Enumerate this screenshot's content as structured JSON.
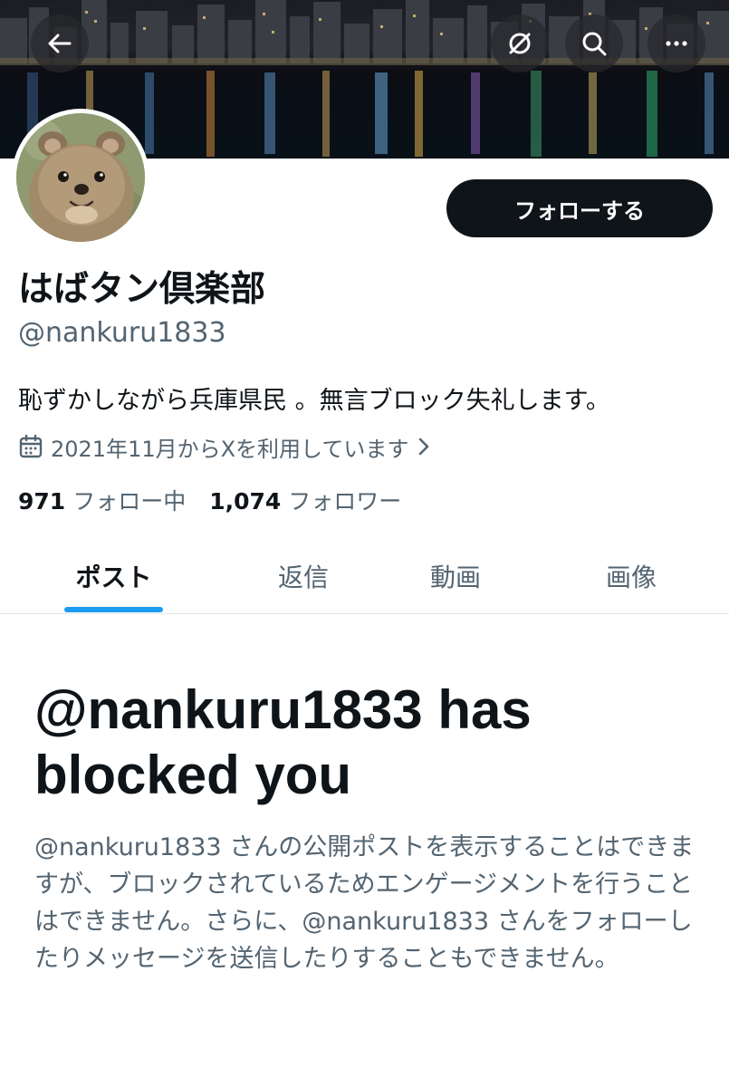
{
  "header": {
    "back_icon": "arrow-left-icon",
    "actions": [
      {
        "name": "hide-icon",
        "label": "repost-hide"
      },
      {
        "name": "search-icon",
        "label": "search"
      },
      {
        "name": "more-icon",
        "label": "more"
      }
    ]
  },
  "profile": {
    "display_name": "はばタン倶楽部",
    "handle": "@nankuru1833",
    "bio": "恥ずかしながら兵庫県民 。無言ブロック失礼します。",
    "joined": "2021年11月からXを利用しています",
    "follow_button": "フォローする",
    "following_count": "971",
    "following_label": "フォロー中",
    "followers_count": "1,074",
    "followers_label": "フォロワー"
  },
  "tabs": [
    {
      "label": "ポスト",
      "active": true
    },
    {
      "label": "返信",
      "active": false
    },
    {
      "label": "動画",
      "active": false
    },
    {
      "label": "画像",
      "active": false
    }
  ],
  "blocked": {
    "title": "@nankuru1833 has blocked you",
    "description": "@nankuru1833 さんの公開ポストを表示することはできますが、ブロックされているためエンゲージメントを行うことはできません。さらに、@nankuru1833 さんをフォローしたりメッセージを送信したりすることもできません。"
  },
  "colors": {
    "accent": "#1d9bf0",
    "text_primary": "#0f1419",
    "text_secondary": "#536471",
    "button_bg": "#0f1419"
  }
}
